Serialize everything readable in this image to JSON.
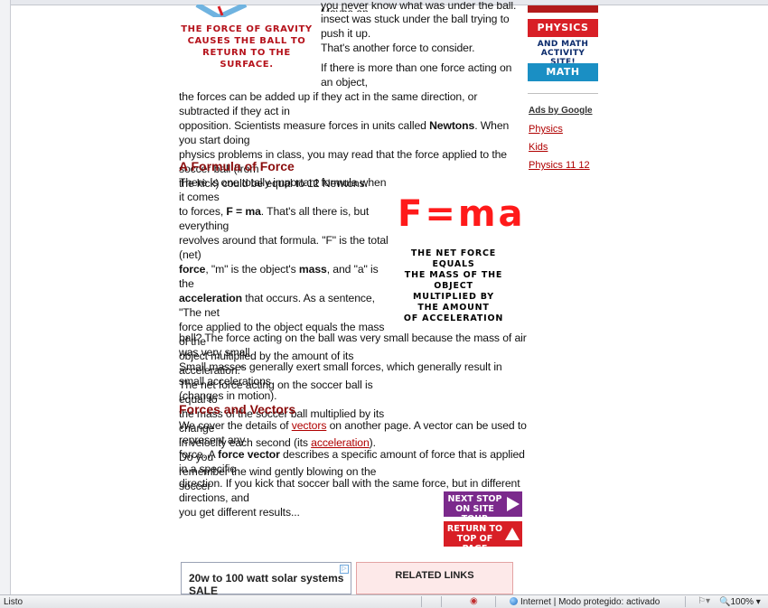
{
  "status_bar": {
    "status_text": "Listo",
    "zone_text": "Internet | Modo protegido: activado",
    "zoom": "100%"
  },
  "top": {
    "partial_line": "you never know what was under the ball. Maybe an",
    "insect_line1": "insect was stuck under the ball trying to push it up.",
    "insect_line2": "That's another force to consider.",
    "gravity_caption": [
      "THE FORCE OF GRAVITY",
      "CAUSES THE BALL TO",
      "RETURN TO THE SURFACE."
    ]
  },
  "para1": {
    "lines": [
      "If there is more than one force acting on an object,",
      "the forces can be added up if they act in the same direction, or subtracted if they act in",
      "opposition. Scientists measure forces in units called ",
      "physics problems in class, you may read that the force applied to the soccer ball (from",
      "the kick) could be equal to 12 Newtons."
    ],
    "newtons_bold": "Newtons",
    "line3_rest": ". When you start doing"
  },
  "formula_section": {
    "heading": "A Formula of Force",
    "text": [
      "There is one totally important formula when it comes",
      "to forces, ",
      "F = ma",
      ". That's all there is, but everything",
      "revolves around that formula. \"F\" is the total (net)",
      "force",
      ", \"m\" is the object's ",
      "mass",
      ", and \"a\" is the",
      "acceleration",
      " that occurs. As a sentence, \"The net",
      "force applied to the object equals the mass of the",
      "object multiplied by the amount of its acceleration.\"",
      "The net force acting on the soccer ball is equal to",
      "the mass of the soccer ball multiplied by its change",
      "in velocity each second (its ",
      "acceleration",
      "). Do you",
      "remember the wind gently blowing on the soccer",
      "ball? The force acting on the ball was very small because the mass of air was very small.",
      "Small masses generally exert small forces, which generally result in small accelerations",
      "(changes in motion)."
    ],
    "formula_graphic": "F=ma",
    "formula_caption": [
      "THE NET FORCE EQUALS",
      "THE MASS OF THE OBJECT",
      "MULTIPLIED BY",
      "THE AMOUNT",
      "OF ACCELERATION"
    ]
  },
  "vectors_section": {
    "heading": "Forces and Vectors",
    "l1a": "We cover the details of ",
    "l1link": "vectors",
    "l1b": " on another page. A vector can be used to represent any",
    "l2a": "force. A ",
    "l2bold": "force vector",
    "l2b": " describes a specific amount of force that is applied in a specific",
    "l3": "direction. If you kick that soccer ball with the same force, but in different directions, and",
    "l4": "you get different results..."
  },
  "nav": {
    "next_stop": [
      "NEXT STOP",
      "ON SITE TOUR"
    ],
    "return_top": [
      "RETURN TO",
      "TOP OF PAGE"
    ]
  },
  "sidebar": {
    "physics_label": "PHYSICS",
    "and_math": [
      "AND MATH",
      "ACTIVITY SITE!"
    ],
    "math_label": "MATH",
    "ads_by_google": "Ads by Google",
    "links": [
      "Physics",
      "Kids",
      "Physics 11 12"
    ]
  },
  "bottom": {
    "ad_text": "20w to 100 watt solar systems SALE",
    "related_links": "RELATED LINKS"
  },
  "colors": {
    "heading": "#8b0d0d",
    "link": "#b00000",
    "physics_bg": "#d81f26",
    "math_bg": "#1a8fc4",
    "next_stop_bg": "#7b2a8c",
    "return_top_bg": "#d81f26"
  }
}
